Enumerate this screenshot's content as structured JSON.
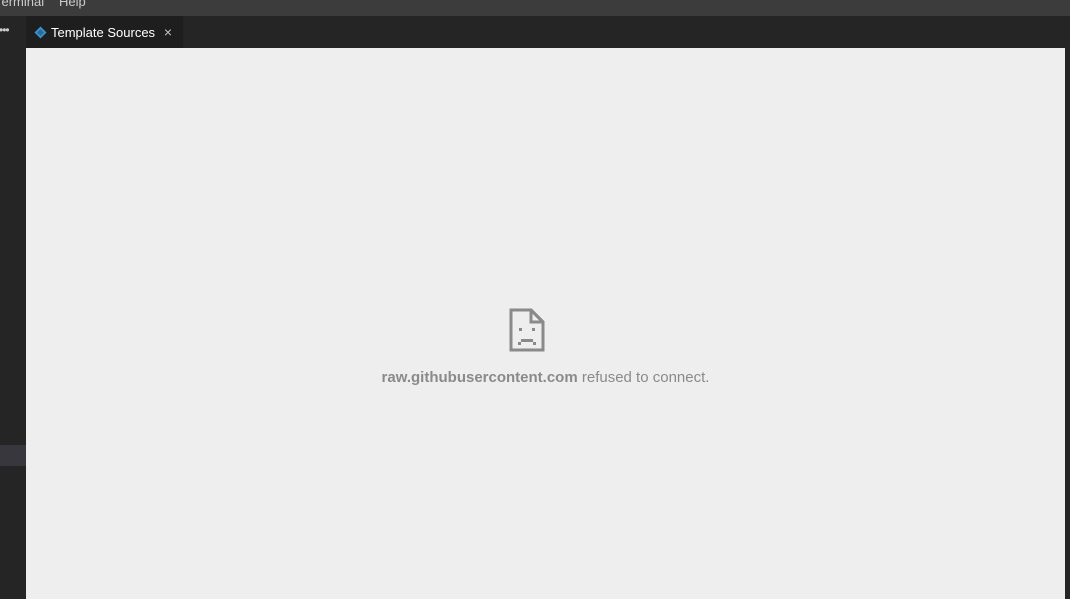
{
  "menubar": {
    "items": [
      {
        "label": "Terminal"
      },
      {
        "label": "Help"
      }
    ]
  },
  "sidebar": {
    "more_icon": "ellipsis-icon",
    "more_label": "•••"
  },
  "tabs": [
    {
      "label": "Template Sources",
      "icon": "extension-diamond-icon",
      "close_label": "×",
      "active": true
    }
  ],
  "webview": {
    "error": {
      "icon": "sad-document-icon",
      "host": "raw.githubusercontent.com",
      "message": " refused to connect."
    }
  },
  "colors": {
    "menubar_bg": "#3c3c3c",
    "sidebar_bg": "#252526",
    "tab_active_bg": "#1e1e1e",
    "webview_bg": "#eeeeee",
    "error_text": "#8a8a8a",
    "tab_icon": "#3794d1"
  }
}
